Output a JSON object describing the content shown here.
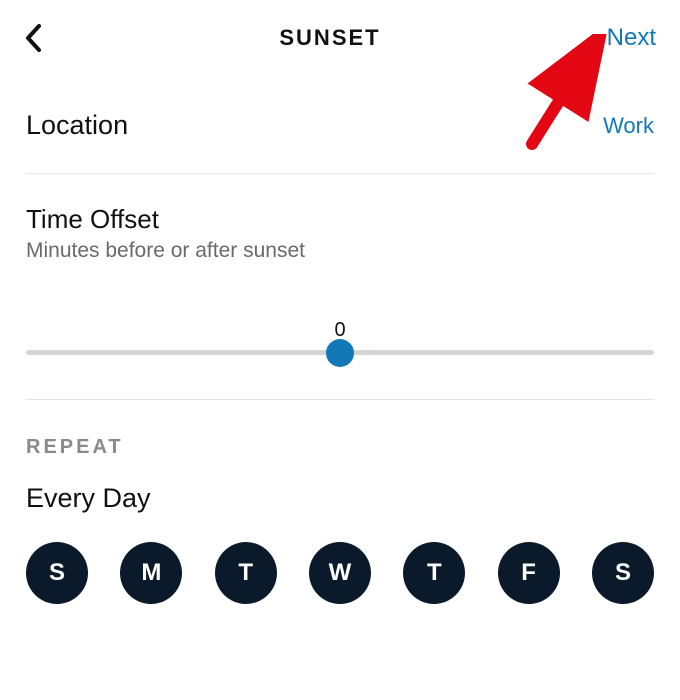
{
  "header": {
    "title": "SUNSET",
    "next_label": "Next"
  },
  "location": {
    "label": "Location",
    "value": "Work"
  },
  "time_offset": {
    "title": "Time Offset",
    "subtitle": "Minutes before or after sunset",
    "value": "0"
  },
  "repeat": {
    "section_label": "REPEAT",
    "value": "Every Day",
    "days": [
      "S",
      "M",
      "T",
      "W",
      "T",
      "F",
      "S"
    ]
  },
  "accent_color": "#1378b6"
}
